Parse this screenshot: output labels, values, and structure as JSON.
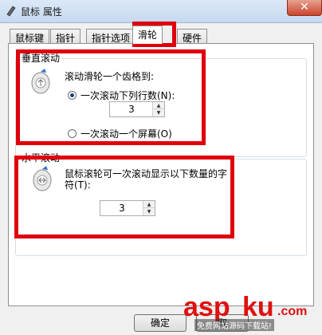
{
  "window": {
    "title": "鼠标 属性",
    "close_label": "✕"
  },
  "tabs": [
    {
      "label": "鼠标键",
      "active": false
    },
    {
      "label": "指针",
      "active": false
    },
    {
      "label": "指针选项",
      "active": false
    },
    {
      "label": "滑轮",
      "active": true
    },
    {
      "label": "硬件",
      "active": false
    }
  ],
  "vertical": {
    "group_title": "垂直滚动",
    "caption": "滚动滑轮一个齿格到:",
    "option_lines_label": "一次滚动下列行数(N):",
    "option_lines_checked": true,
    "lines_value": "3",
    "option_screen_label": "一次滚动一个屏幕(O)",
    "option_screen_checked": false
  },
  "horizontal": {
    "group_title": "水平滚动",
    "caption_line1": "鼠标滚轮可一次滚动显示以下数量的字",
    "caption_line2": "符(T):",
    "chars_value": "3"
  },
  "footer": {
    "ok_label": "确定",
    "cancel_label": "取"
  },
  "watermark": {
    "brand_left": "asp",
    "brand_right": "ku",
    "brand_suffix": ".com",
    "subtitle": "免费网站源码下载站!"
  },
  "colors": {
    "highlight_box": "#e0000c",
    "accent": "#1d3f7a"
  }
}
